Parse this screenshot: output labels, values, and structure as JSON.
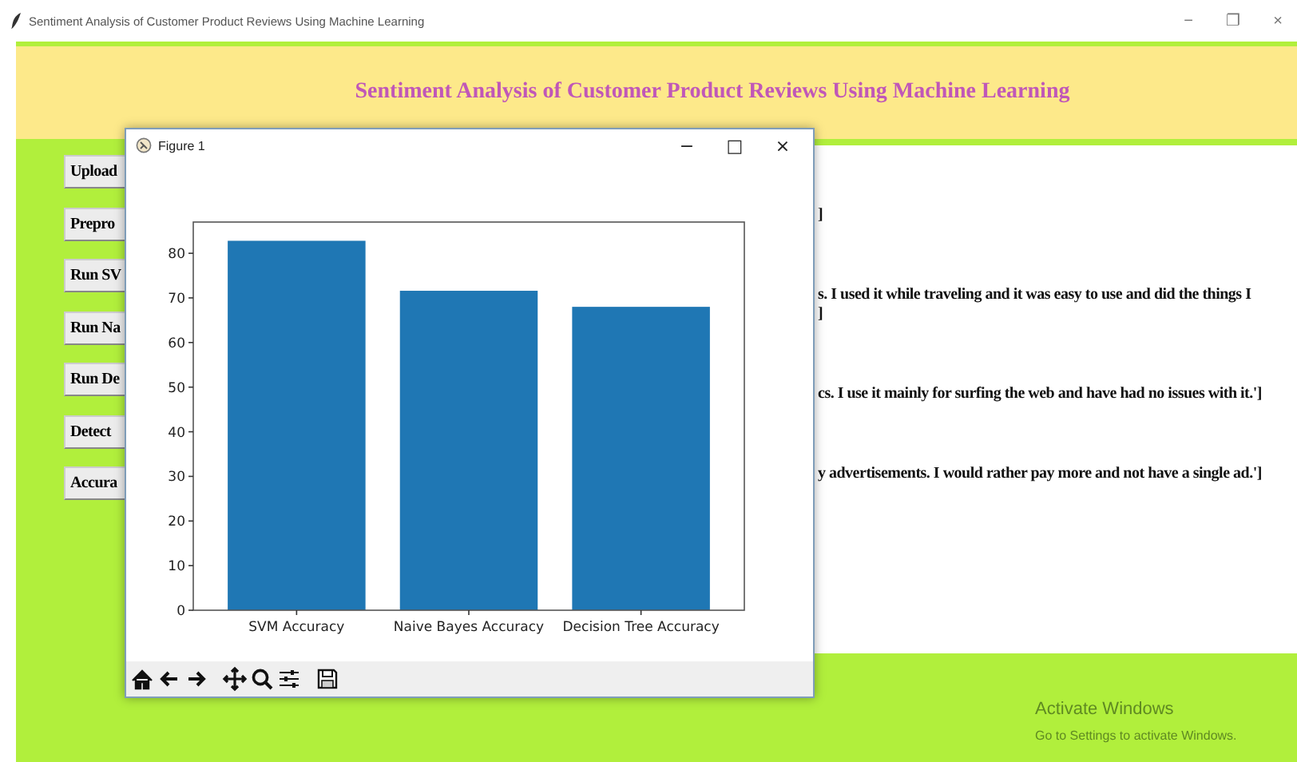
{
  "window": {
    "title": "Sentiment Analysis of Customer Product Reviews Using Machine Learning",
    "controls": [
      "−",
      "❐",
      "×"
    ]
  },
  "header": {
    "title": "Sentiment Analysis of Customer Product Reviews Using Machine Learning"
  },
  "buttons": [
    "Upload",
    "Prepro",
    "Run SV",
    "Run Na",
    "Run De",
    "Detect",
    "Accura"
  ],
  "output_lines": [
    "]",
    "s. I used it while traveling and it was easy to use and did the things I",
    "]",
    "cs. I use it mainly for surfing the web and have had no issues with it.']",
    "y advertisements. I would rather pay more and not have a single ad.']"
  ],
  "figure": {
    "title": "Figure 1",
    "controls": [
      "−",
      "□",
      "×"
    ],
    "chart_data": {
      "type": "bar",
      "categories": [
        "SVM Accuracy",
        "Naive Bayes Accuracy",
        "Decision Tree Accuracy"
      ],
      "series": [
        {
          "color": "#1f77b4",
          "values": [
            82.8,
            71.6,
            68.0
          ]
        }
      ],
      "ylim": [
        0,
        87
      ],
      "yticks": [
        0,
        10,
        20,
        30,
        40,
        50,
        60,
        70,
        80
      ]
    }
  },
  "os_notice": {
    "title": "Activate Windows",
    "subtitle": "Go to Settings to activate Windows."
  }
}
